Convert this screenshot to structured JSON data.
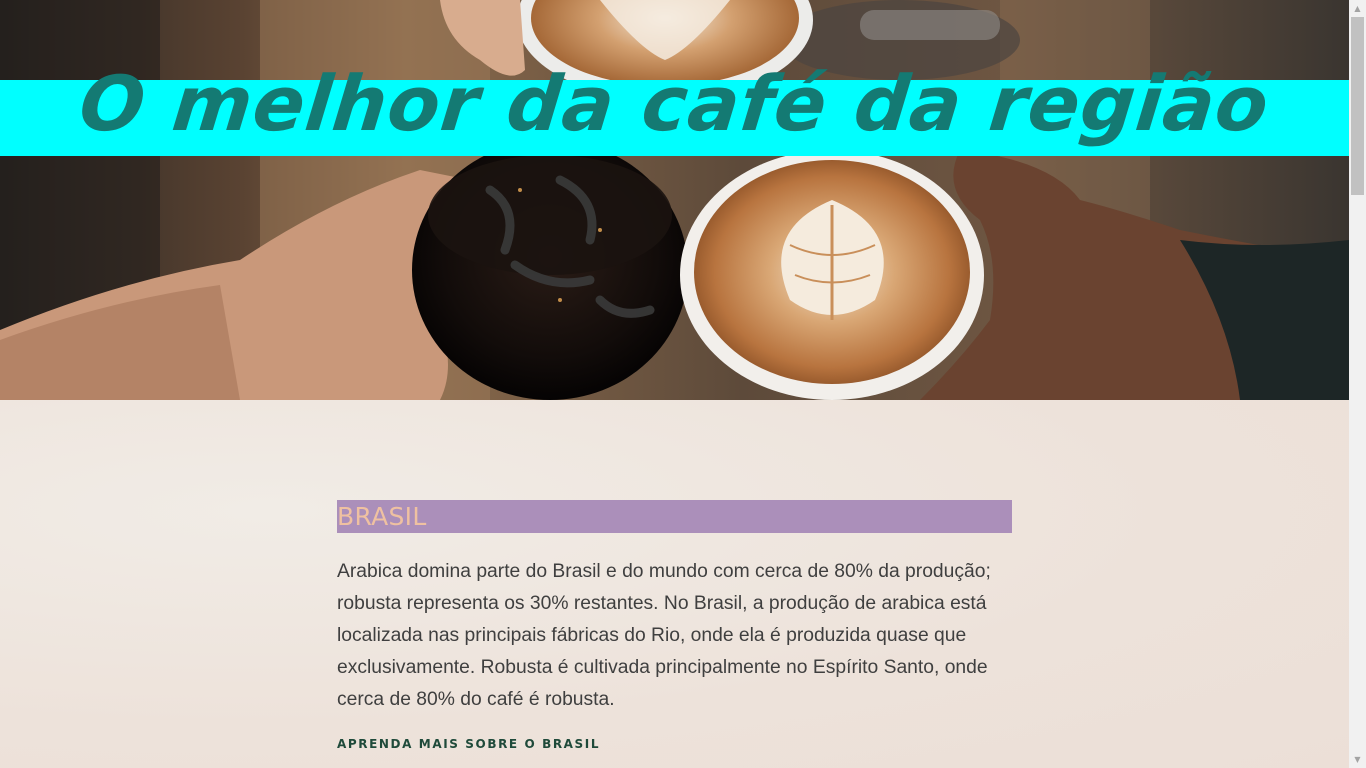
{
  "hero": {
    "headline": "O melhor da café da região",
    "image_description_icon": "coffee-cups-photo"
  },
  "section": {
    "title": "BRASIL",
    "body": "Arabica domina parte do Brasil e do mundo com cerca de 80% da produção; robusta representa os 30% restantes. No Brasil, a produção de arabica está localizada nas principais fábricas do Rio, onde ela é produzida quase que exclusivamente. Robusta é cultivada principalmente no Espírito Santo, onde cerca de 80% do café é robusta.",
    "link_label": "APRENDA MAIS SOBRE O BRASIL"
  },
  "scrollbar": {
    "up_icon": "arrow-up-icon",
    "down_icon": "arrow-down-icon"
  },
  "colors": {
    "banner": "#00ffff",
    "headline": "#147a73",
    "title_bg": "#ab8fba",
    "title_text": "#efc1a1",
    "body_text": "#3f3f3f",
    "link_text": "#1f4a3a",
    "page_bg": "#efe4dc"
  }
}
